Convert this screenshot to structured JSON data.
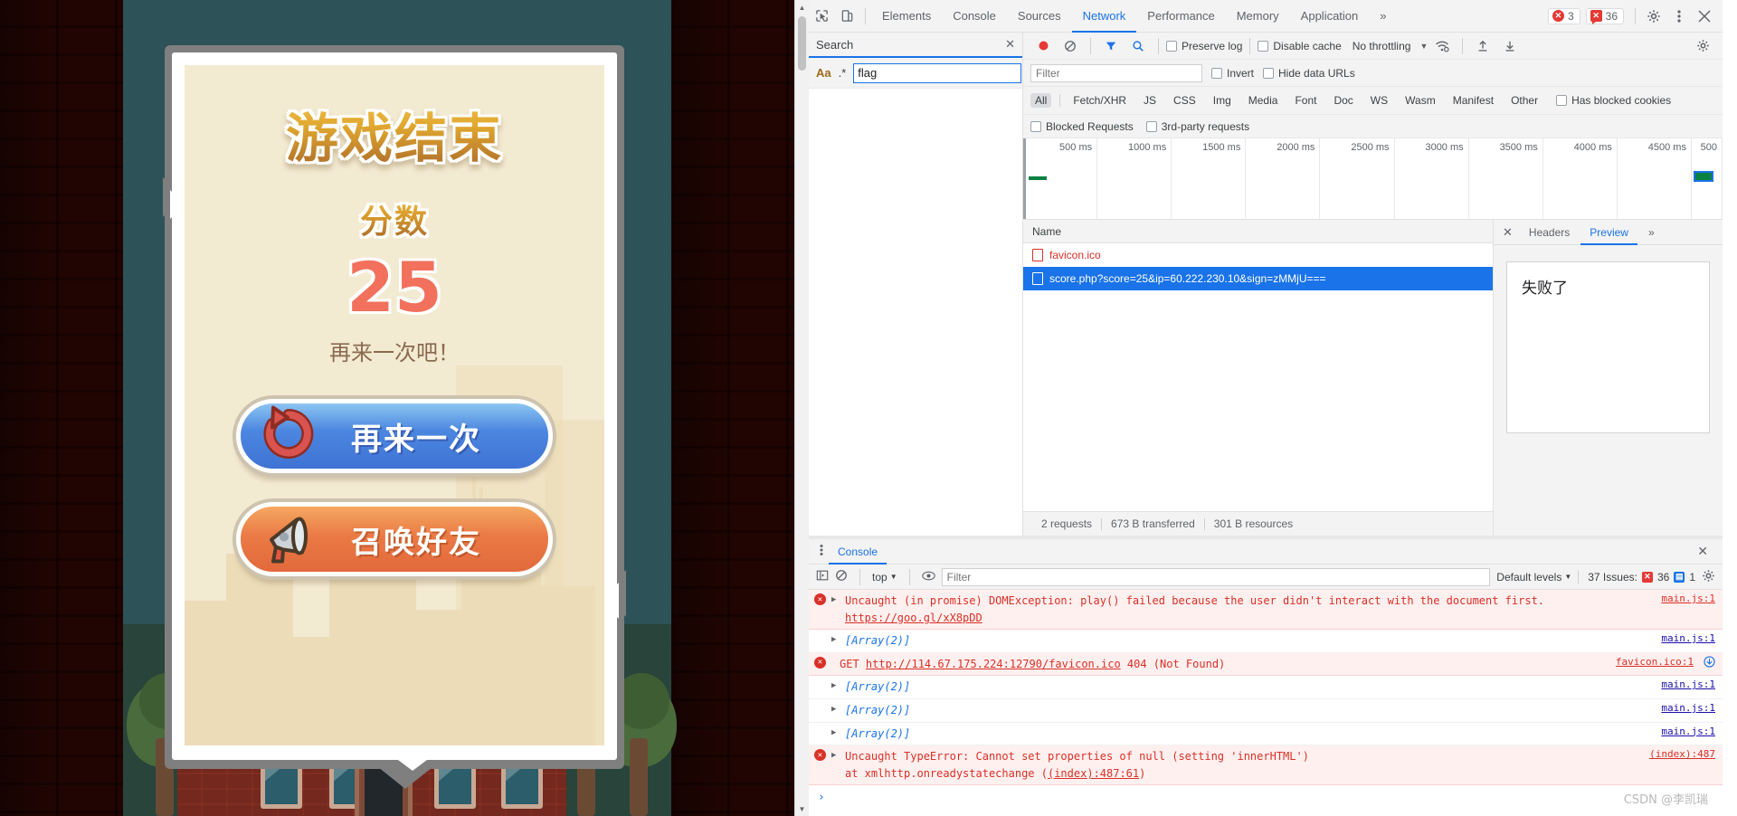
{
  "game": {
    "dialog": {
      "title": "游戏结束",
      "score_label": "分数",
      "score_value": "25",
      "hint": "再来一次吧！",
      "buttons": [
        {
          "label": "再来一次",
          "icon": "refresh-icon",
          "color": "#4b86e0"
        },
        {
          "label": "召唤好友",
          "icon": "megaphone-icon",
          "color": "#ea7a45"
        }
      ]
    }
  },
  "devtools": {
    "tabs": [
      {
        "label": "Elements",
        "active": false
      },
      {
        "label": "Console",
        "active": false
      },
      {
        "label": "Sources",
        "active": false
      },
      {
        "label": "Network",
        "active": true
      },
      {
        "label": "Performance",
        "active": false
      },
      {
        "label": "Memory",
        "active": false
      },
      {
        "label": "Application",
        "active": false
      }
    ],
    "overflow_tabs": "»",
    "error_badge": "3",
    "warning_badge": "36",
    "icons": {
      "inspect": "inspect-icon",
      "device": "device-toolbar-icon",
      "settings": "gear-icon",
      "more": "kebab-menu-icon",
      "close": "close-icon"
    },
    "search": {
      "panel_title": "Search",
      "close": "✕",
      "match_case": "Aa",
      "regex": ".*",
      "query": "flag",
      "refresh": "refresh-icon",
      "clear": "clear-icon"
    },
    "network": {
      "toolbar": {
        "record": "record-icon",
        "clear": "clear-icon",
        "filter": "filter-icon",
        "search": "search-icon",
        "preserve_log": "Preserve log",
        "disable_cache": "Disable cache",
        "throttling": "No throttling",
        "wifi": "network-conditions-icon",
        "import": "import-har-icon",
        "export": "export-har-icon",
        "settings": "gear-icon"
      },
      "filter_placeholder": "Filter",
      "filter_value": "",
      "invert": "Invert",
      "hide_data_urls": "Hide data URLs",
      "types": [
        "All",
        "Fetch/XHR",
        "JS",
        "CSS",
        "Img",
        "Media",
        "Font",
        "Doc",
        "WS",
        "Wasm",
        "Manifest",
        "Other"
      ],
      "active_type": "All",
      "has_blocked_cookies": "Has blocked cookies",
      "blocked_requests": "Blocked Requests",
      "third_party": "3rd-party requests",
      "timeline_ticks": [
        "500 ms",
        "1000 ms",
        "1500 ms",
        "2000 ms",
        "2500 ms",
        "3000 ms",
        "3500 ms",
        "4000 ms",
        "4500 ms",
        "500"
      ],
      "column_name": "Name",
      "requests": [
        {
          "name": "favicon.ico",
          "state": "error",
          "selected": false
        },
        {
          "name": "score.php?score=25&ip=60.222.230.10&sign=zMMjU===",
          "state": "normal",
          "selected": true
        }
      ],
      "status": {
        "requests": "2 requests",
        "transferred": "673 B transferred",
        "resources": "301 B resources"
      }
    },
    "detail": {
      "close": "✕",
      "tabs": [
        {
          "label": "Headers",
          "active": false
        },
        {
          "label": "Preview",
          "active": true
        }
      ],
      "overflow": "»",
      "preview_text": "失败了"
    },
    "console": {
      "tab": "Console",
      "close": "✕",
      "kebab": "kebab-menu-icon",
      "sidebar_toggle": "console-sidebar-icon",
      "clear": "clear-icon",
      "context": "top",
      "eye": "live-expression-icon",
      "filter_placeholder": "Filter",
      "levels": "Default levels",
      "issues_label": "37 Issues:",
      "issues_errors": "36",
      "issues_info": "1",
      "settings": "gear-icon",
      "messages": [
        {
          "type": "error",
          "expandable": true,
          "text": "Uncaught (in promise) DOMException: play() failed because the user didn't interact with the document first. ",
          "link": "https://goo.gl/xX8pDD",
          "source": "main.js:1"
        },
        {
          "type": "log",
          "expandable": true,
          "text": "[Array(2)]",
          "source": "main.js:1"
        },
        {
          "type": "error",
          "expandable": false,
          "prefix": "GET ",
          "url": "http://114.67.175.224:12790/favicon.ico",
          "text": " 404 (Not Found)",
          "source": "favicon.ico:1"
        },
        {
          "type": "log",
          "expandable": true,
          "text": "[Array(2)]",
          "source": "main.js:1"
        },
        {
          "type": "log",
          "expandable": true,
          "text": "[Array(2)]",
          "source": "main.js:1"
        },
        {
          "type": "log",
          "expandable": true,
          "text": "[Array(2)]",
          "source": "main.js:1"
        },
        {
          "type": "error",
          "expandable": true,
          "text": "Uncaught TypeError: Cannot set properties of null (setting 'innerHTML')",
          "text2": "    at xmlhttp.onreadystatechange (",
          "link2": "(index):487:61",
          "text3": ")",
          "source": "(index):487"
        }
      ],
      "prompt": "›"
    }
  },
  "watermark": "CSDN @李凯瑞"
}
